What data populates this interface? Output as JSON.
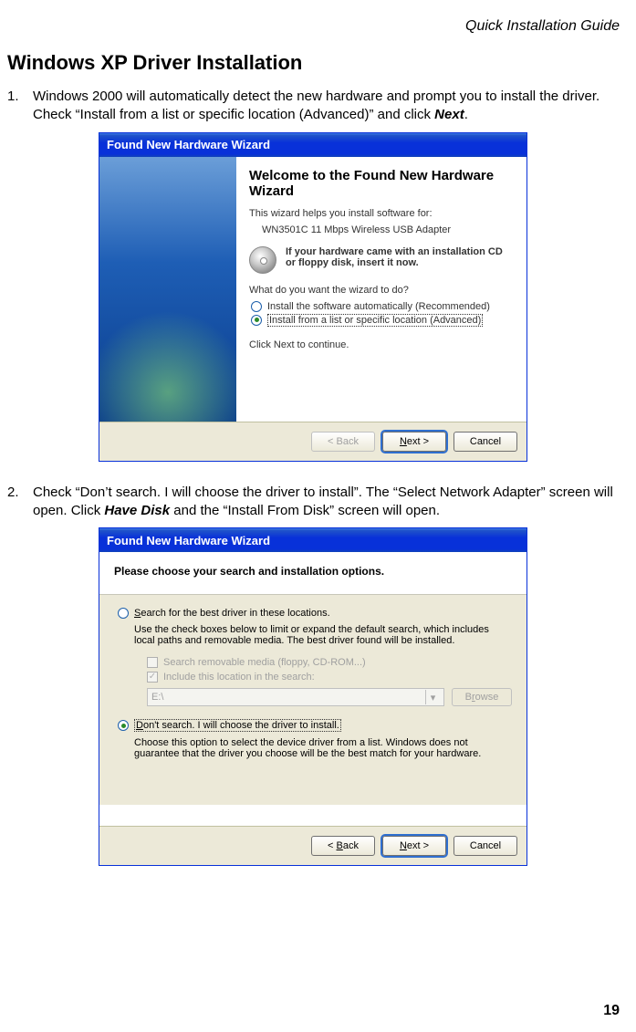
{
  "header": {
    "running_title": "Quick Installation Guide"
  },
  "section": {
    "title": "Windows XP Driver Installation"
  },
  "steps": [
    {
      "num": "1.",
      "text_before": "Windows 2000 will automatically detect the new hardware and prompt you to install the driver. Check “Install from a list or specific location (Advanced)” and click ",
      "text_emph": "Next",
      "text_after": "."
    },
    {
      "num": "2.",
      "text_before": "Check “Don’t search. I will choose the driver to install”. The “Select Network Adapter” screen will open. Click ",
      "text_emph": "Have Disk",
      "text_after": " and the “Install From Disk” screen will open."
    }
  ],
  "wizard1": {
    "titlebar": "Found New Hardware Wizard",
    "heading": "Welcome to the Found New Hardware Wizard",
    "intro": "This wizard helps you install software for:",
    "device": "WN3501C 11 Mbps Wireless USB Adapter",
    "cd_text": "If your hardware came with an installation CD or floppy disk, insert it now.",
    "question": "What do you want the wizard to do?",
    "opt1": "Install the software automatically (Recommended)",
    "opt2": "Install from a list or specific location (Advanced)",
    "continue": "Click Next to continue.",
    "buttons": {
      "back": "< Back",
      "next": "Next >",
      "cancel": "Cancel"
    }
  },
  "wizard2": {
    "titlebar": "Found New Hardware Wizard",
    "heading": "Please choose your search and installation options.",
    "opt1_label": "Search for the best driver in these locations.",
    "opt1_desc": "Use the check boxes below to limit or expand the default search, which includes local paths and removable media. The best driver found will be installed.",
    "sub1": "Search removable media (floppy, CD-ROM...)",
    "sub2": "Include this location in the search:",
    "path": "E:\\",
    "browse": "Browse",
    "opt2_label": "Don't search. I will choose the driver to install.",
    "opt2_desc": "Choose this option to select the device driver from a list.  Windows does not guarantee that the driver you choose will be the best match for your hardware.",
    "buttons": {
      "back": "< Back",
      "next": "Next >",
      "cancel": "Cancel"
    }
  },
  "page_number": "19"
}
